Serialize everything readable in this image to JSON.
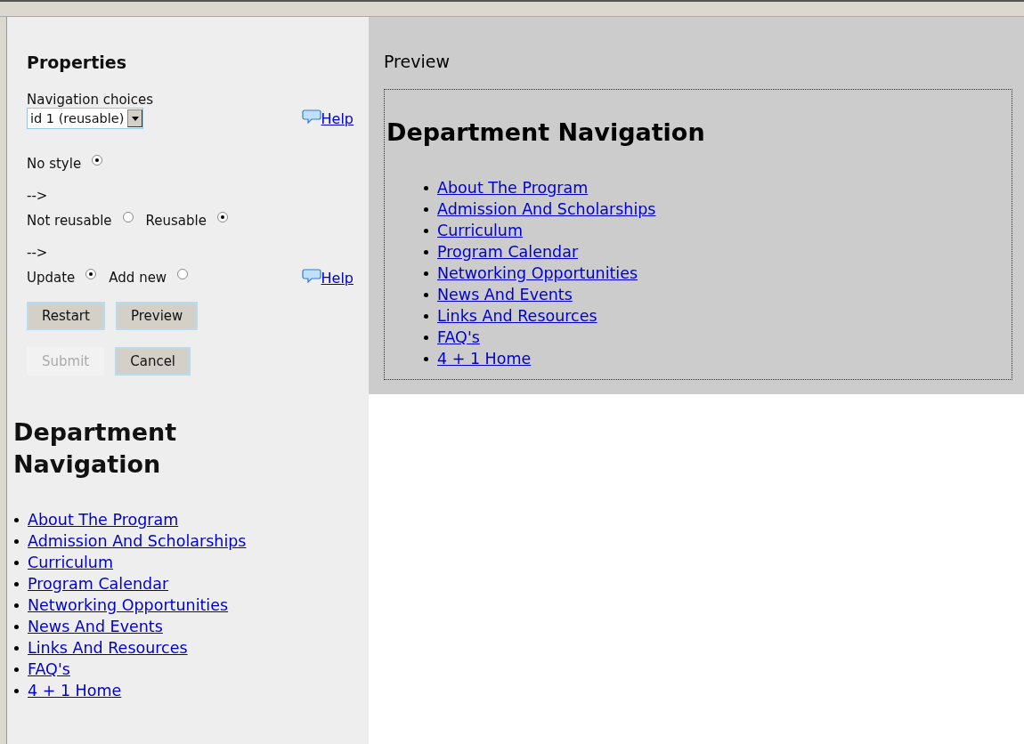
{
  "properties": {
    "title": "Properties",
    "navigation_choices": {
      "label": "Navigation choices",
      "value": "id 1 (reusable)",
      "help": "Help"
    },
    "items": [
      {
        "kind": "radios",
        "options": [
          {
            "label": "No style",
            "selected": true
          }
        ]
      },
      {
        "kind": "text",
        "text": "-->"
      },
      {
        "kind": "radios",
        "options": [
          {
            "label": "Not reusable",
            "selected": false
          },
          {
            "label": "Reusable",
            "selected": true
          }
        ]
      },
      {
        "kind": "text",
        "text": "-->"
      },
      {
        "kind": "radios",
        "options": [
          {
            "label": "Update",
            "selected": true
          },
          {
            "label": "Add new",
            "selected": false
          }
        ],
        "help": "Help"
      }
    ],
    "button_rows": [
      [
        {
          "label": "Restart",
          "disabled": false
        },
        {
          "label": "Preview",
          "disabled": false
        }
      ],
      [
        {
          "label": "Submit",
          "disabled": true
        },
        {
          "label": "Cancel",
          "disabled": false
        }
      ]
    ]
  },
  "sidebar_navigation": {
    "heading": "Department Navigation",
    "links": [
      "About The Program",
      "Admission And Scholarships",
      "Curriculum",
      "Program Calendar",
      "Networking Opportunities",
      "News And Events",
      "Links And Resources",
      "FAQ's",
      "4 + 1 Home"
    ]
  },
  "preview": {
    "title": "Preview",
    "heading": "Department Navigation",
    "links": [
      "About The Program",
      "Admission And Scholarships",
      "Curriculum",
      "Program Calendar",
      "Networking Opportunities",
      "News And Events",
      "Links And Resources",
      "FAQ's",
      "4 + 1 Home"
    ]
  }
}
